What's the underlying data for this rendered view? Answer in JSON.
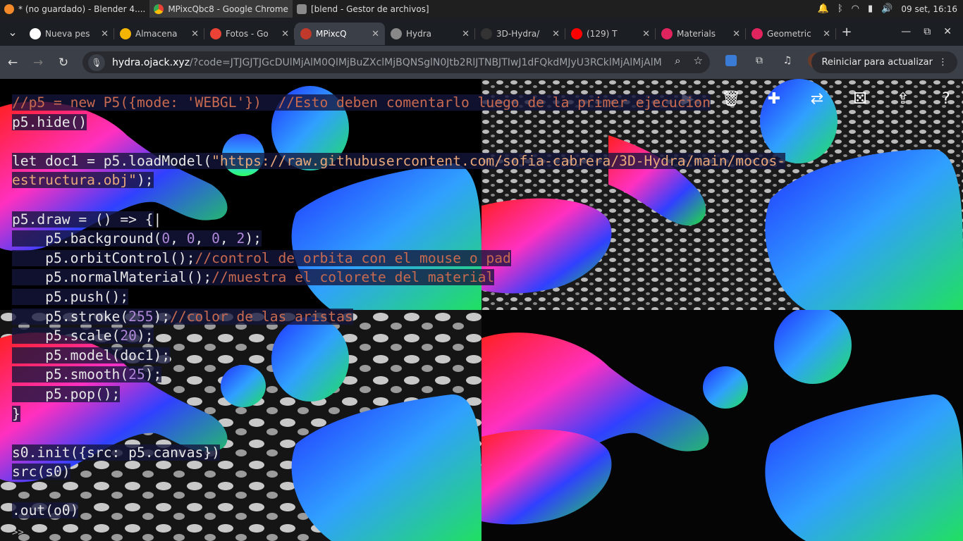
{
  "taskbar": {
    "tasks": [
      {
        "label": "* (no guardado) - Blender 4....",
        "icon": "blender-icon",
        "color": "#f58a2a"
      },
      {
        "label": "MPixcQbc8 - Google Chrome",
        "icon": "chrome-icon",
        "color": "#4285f4"
      },
      {
        "label": "[blend - Gestor de archivos]",
        "icon": "folder-icon",
        "color": "#c9a060"
      }
    ],
    "clock": "09 set, 16:16"
  },
  "tabs": [
    {
      "title": "Nueva pes",
      "icon": "chrome-tab-icon",
      "color": "#ffffff"
    },
    {
      "title": "Almacena",
      "icon": "google-drive-icon",
      "color": "#f4b400"
    },
    {
      "title": "Fotos - Go",
      "icon": "google-photos-icon",
      "color": "#ea4335"
    },
    {
      "title": "MPixcQ",
      "icon": "hydra-tab-icon",
      "color": "#c0392b",
      "active": true
    },
    {
      "title": "Hydra",
      "icon": "globe-icon",
      "color": "#888888"
    },
    {
      "title": "3D-Hydra/",
      "icon": "github-icon",
      "color": "#333333"
    },
    {
      "title": "(129) T",
      "icon": "youtube-icon",
      "color": "#ff0000"
    },
    {
      "title": "Materials",
      "icon": "star-icon",
      "color": "#e0245e"
    },
    {
      "title": "Geometric",
      "icon": "star-icon",
      "color": "#e0245e"
    }
  ],
  "toolbar": {
    "url_host": "hydra.ojack.xyz",
    "url_rest": "/?code=JTJGJTJGcDUlMjAlM0QlMjBuZXclMjBQNSglN0Jtb2RlJTNBJTIwJ1dFQkdMJyU3RCklMjAlMjAlMkYl...",
    "update_label": "Reiniciar para actualizar"
  },
  "editor": {
    "prompt": ">>"
  }
}
